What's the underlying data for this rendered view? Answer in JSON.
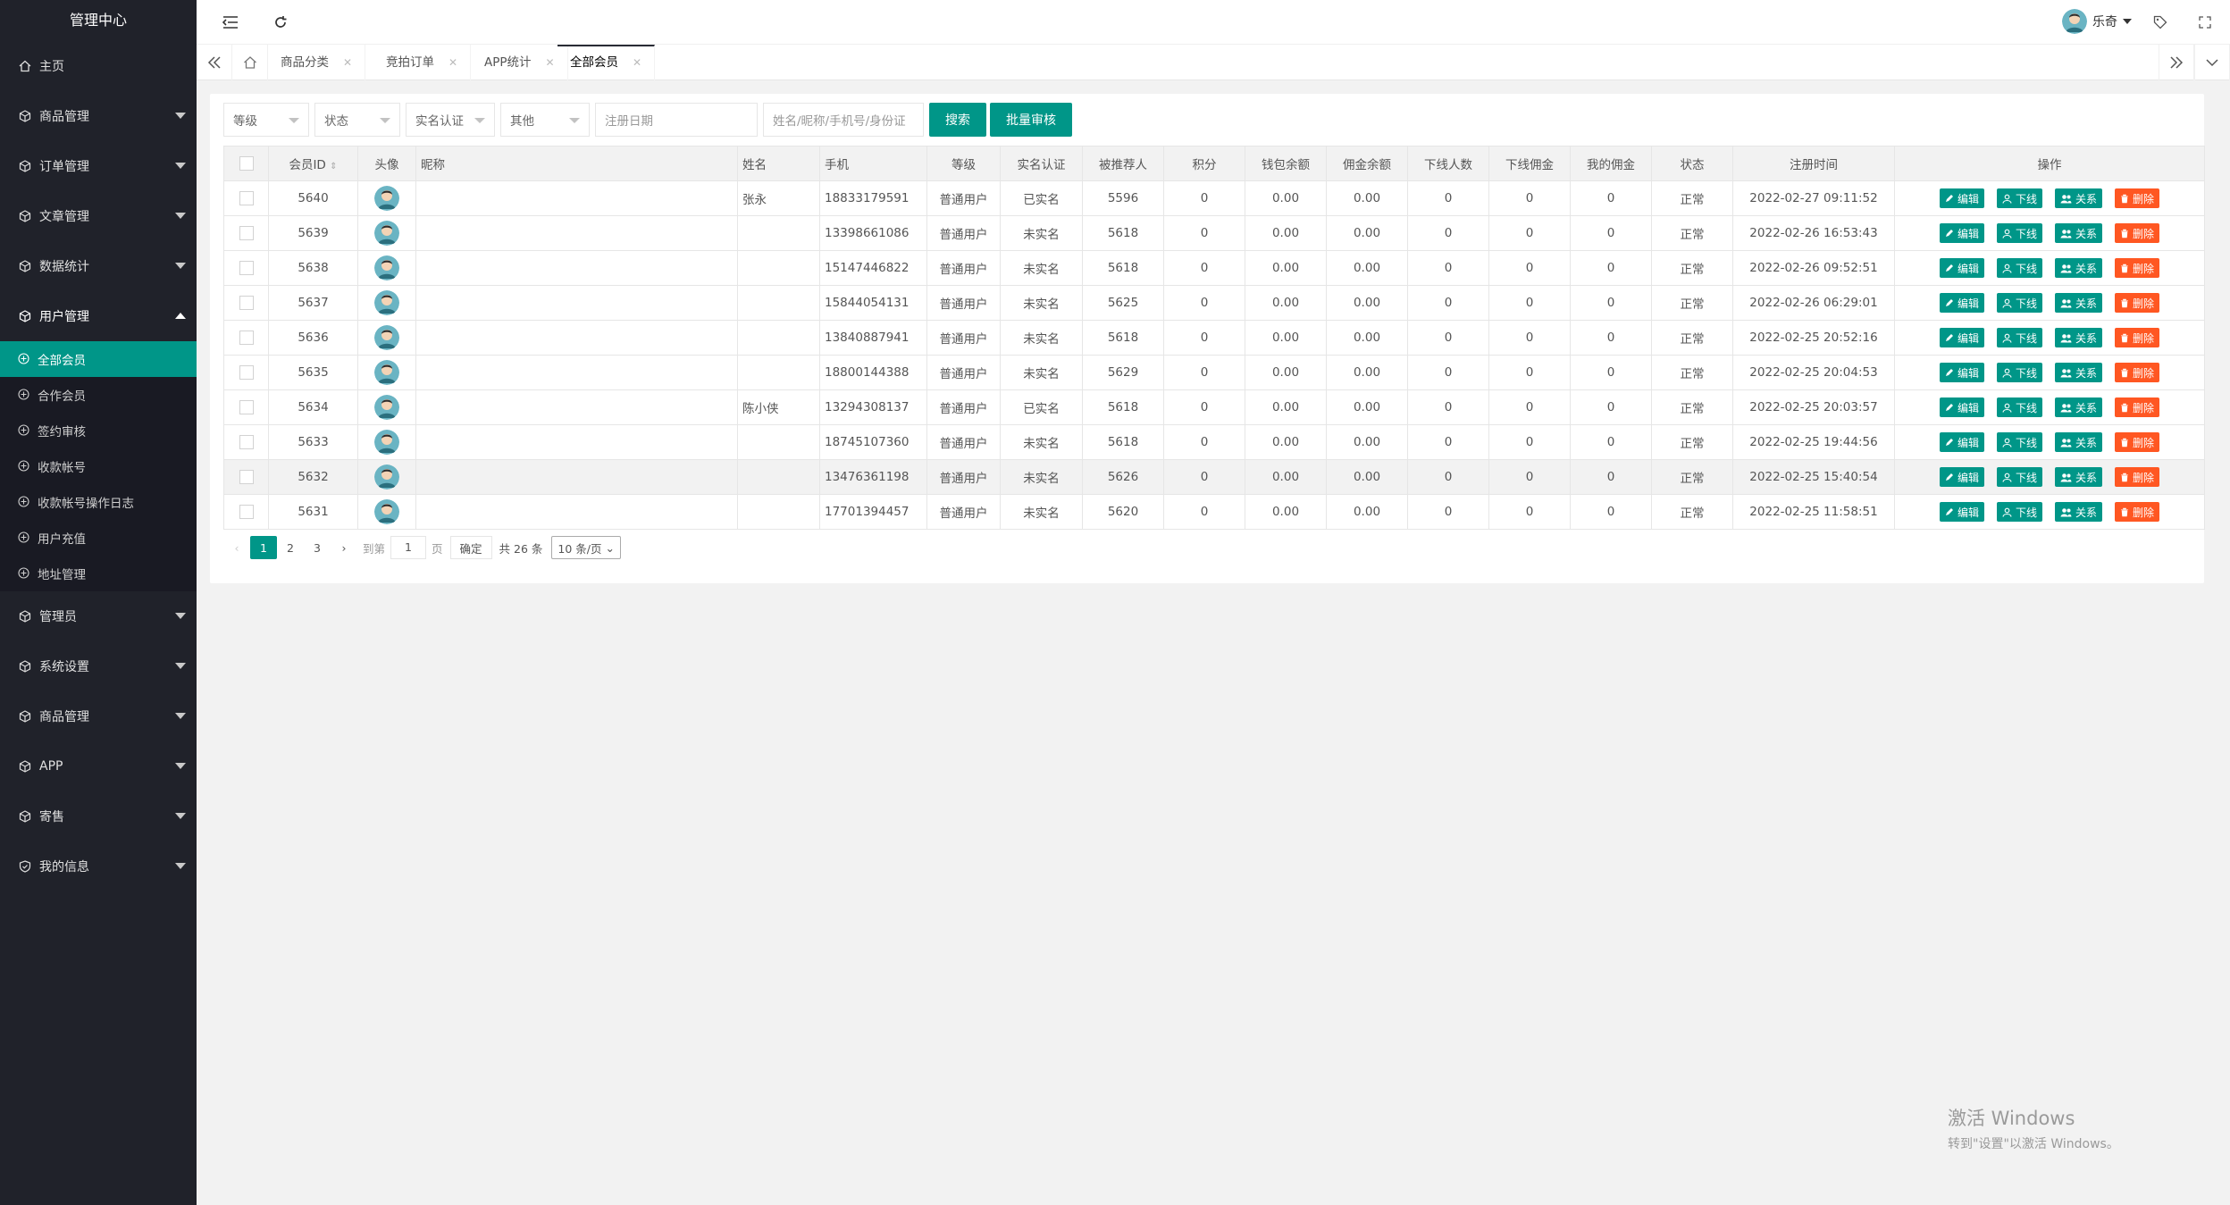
{
  "sidebar": {
    "title": "管理中心",
    "items": [
      {
        "label": "主页",
        "caret": false
      },
      {
        "label": "商品管理",
        "caret": true
      },
      {
        "label": "订单管理",
        "caret": true
      },
      {
        "label": "文章管理",
        "caret": true
      },
      {
        "label": "数据统计",
        "caret": true
      },
      {
        "label": "用户管理",
        "caret": true,
        "open": true
      }
    ],
    "sub_items": [
      "全部会员",
      "合作会员",
      "签约审核",
      "收款帐号",
      "收款帐号操作日志",
      "用户充值",
      "地址管理"
    ],
    "items_after": [
      "管理员",
      "系统设置",
      "商品管理",
      "APP",
      "寄售",
      "我的信息"
    ]
  },
  "header": {
    "user_name": "乐奇"
  },
  "tabs": [
    "商品分类",
    "竞拍订单",
    "APP统计",
    "全部会员"
  ],
  "filters": {
    "level": "等级",
    "status": "状态",
    "realname": "实名认证",
    "other": "其他",
    "reg_date": "注册日期",
    "keyword": "姓名/昵称/手机号/身份证",
    "search": "搜索",
    "batch": "批量审核"
  },
  "table": {
    "headers": [
      "会员ID",
      "头像",
      "昵称",
      "姓名",
      "手机",
      "等级",
      "实名认证",
      "被推荐人",
      "积分",
      "钱包余额",
      "佣金余额",
      "下线人数",
      "下线佣金",
      "我的佣金",
      "状态",
      "注册时间",
      "操作"
    ],
    "ops": [
      "编辑",
      "下线",
      "关系",
      "删除"
    ],
    "rows": [
      [
        "5640",
        "",
        "张永",
        "18833179591",
        "普通用户",
        "已实名",
        "5596",
        "0",
        "0.00",
        "0.00",
        "0",
        "0",
        "0",
        "正常",
        "2022-02-27 09:11:52"
      ],
      [
        "5639",
        "",
        "",
        "13398661086",
        "普通用户",
        "未实名",
        "5618",
        "0",
        "0.00",
        "0.00",
        "0",
        "0",
        "0",
        "正常",
        "2022-02-26 16:53:43"
      ],
      [
        "5638",
        "",
        "",
        "15147446822",
        "普通用户",
        "未实名",
        "5618",
        "0",
        "0.00",
        "0.00",
        "0",
        "0",
        "0",
        "正常",
        "2022-02-26 09:52:51"
      ],
      [
        "5637",
        "",
        "",
        "15844054131",
        "普通用户",
        "未实名",
        "5625",
        "0",
        "0.00",
        "0.00",
        "0",
        "0",
        "0",
        "正常",
        "2022-02-26 06:29:01"
      ],
      [
        "5636",
        "",
        "",
        "13840887941",
        "普通用户",
        "未实名",
        "5618",
        "0",
        "0.00",
        "0.00",
        "0",
        "0",
        "0",
        "正常",
        "2022-02-25 20:52:16"
      ],
      [
        "5635",
        "",
        "",
        "18800144388",
        "普通用户",
        "未实名",
        "5629",
        "0",
        "0.00",
        "0.00",
        "0",
        "0",
        "0",
        "正常",
        "2022-02-25 20:04:53"
      ],
      [
        "5634",
        "",
        "陈小侠",
        "13294308137",
        "普通用户",
        "已实名",
        "5618",
        "0",
        "0.00",
        "0.00",
        "0",
        "0",
        "0",
        "正常",
        "2022-02-25 20:03:57"
      ],
      [
        "5633",
        "",
        "",
        "18745107360",
        "普通用户",
        "未实名",
        "5618",
        "0",
        "0.00",
        "0.00",
        "0",
        "0",
        "0",
        "正常",
        "2022-02-25 19:44:56"
      ],
      [
        "5632",
        "",
        "",
        "13476361198",
        "普通用户",
        "未实名",
        "5626",
        "0",
        "0.00",
        "0.00",
        "0",
        "0",
        "0",
        "正常",
        "2022-02-25 15:40:54"
      ],
      [
        "5631",
        "",
        "",
        "17701394457",
        "普通用户",
        "未实名",
        "5620",
        "0",
        "0.00",
        "0.00",
        "0",
        "0",
        "0",
        "正常",
        "2022-02-25 11:58:51"
      ]
    ]
  },
  "pager": {
    "pages": [
      "1",
      "2",
      "3"
    ],
    "goto_label": "到第",
    "goto_value": "1",
    "page_unit": "页",
    "confirm": "确定",
    "total": "共 26 条",
    "per_page": "10 条/页"
  },
  "watermark": {
    "line1": "激活 Windows",
    "line2": "转到\"设置\"以激活 Windows。"
  },
  "colors": {
    "primary": "#009688",
    "danger": "#ff5722",
    "sidebar_bg": "#20222a"
  }
}
